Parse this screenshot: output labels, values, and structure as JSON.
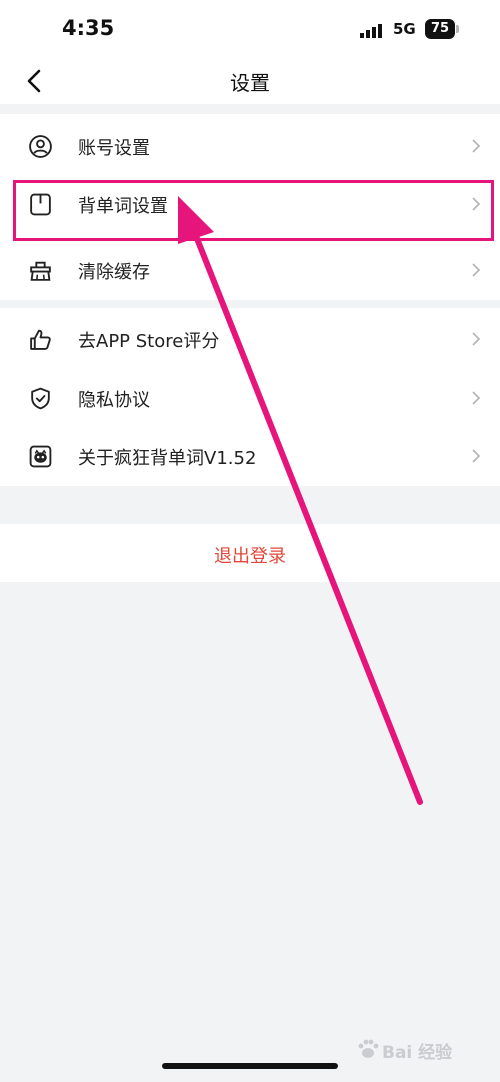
{
  "status_bar": {
    "time": "4:35",
    "network": "5G",
    "battery": "75"
  },
  "header": {
    "title": "设置",
    "back_icon": "chevron-left-icon"
  },
  "settings": {
    "group1": [
      {
        "label": "账号设置",
        "icon": "account-icon"
      },
      {
        "label": "背单词设置",
        "icon": "word-settings-icon"
      },
      {
        "label": "清除缓存",
        "icon": "clear-cache-icon"
      }
    ],
    "group2": [
      {
        "label": "去APP Store评分",
        "icon": "thumbs-up-icon"
      },
      {
        "label": "隐私协议",
        "icon": "shield-check-icon"
      },
      {
        "label": "关于疯狂背单词V1.52",
        "icon": "app-logo-icon"
      }
    ]
  },
  "logout": {
    "label": "退出登录"
  },
  "colors": {
    "annotation": "#e6157c",
    "logout_text": "#e0483b",
    "background": "#f2f3f5"
  },
  "watermark": {
    "text": "Bai 经验",
    "icon": "paw-icon"
  }
}
